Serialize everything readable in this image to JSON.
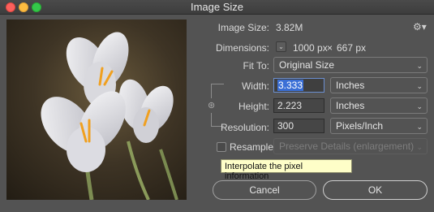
{
  "window": {
    "title": "Image Size"
  },
  "image_size": {
    "label": "Image Size:",
    "value": "3.82M"
  },
  "dimensions": {
    "label": "Dimensions:",
    "width": "1000 px",
    "sep": "×",
    "height": "667 px"
  },
  "fit_to": {
    "label": "Fit To:",
    "selected": "Original Size"
  },
  "width": {
    "label": "Width:",
    "value": "3.333",
    "unit": "Inches"
  },
  "height": {
    "label": "Height:",
    "value": "2.223",
    "unit": "Inches"
  },
  "resolution": {
    "label": "Resolution:",
    "value": "300",
    "unit": "Pixels/Inch"
  },
  "resample": {
    "label": "Resample:",
    "checked": false,
    "method": "Preserve Details (enlargement)"
  },
  "tooltip": {
    "text": "Interpolate the pixel information"
  },
  "buttons": {
    "cancel": "Cancel",
    "ok": "OK"
  },
  "icons": {
    "settings": "gear-icon",
    "constrain": "chain-link-icon",
    "dimensions_menu": "chevron-down-icon"
  }
}
